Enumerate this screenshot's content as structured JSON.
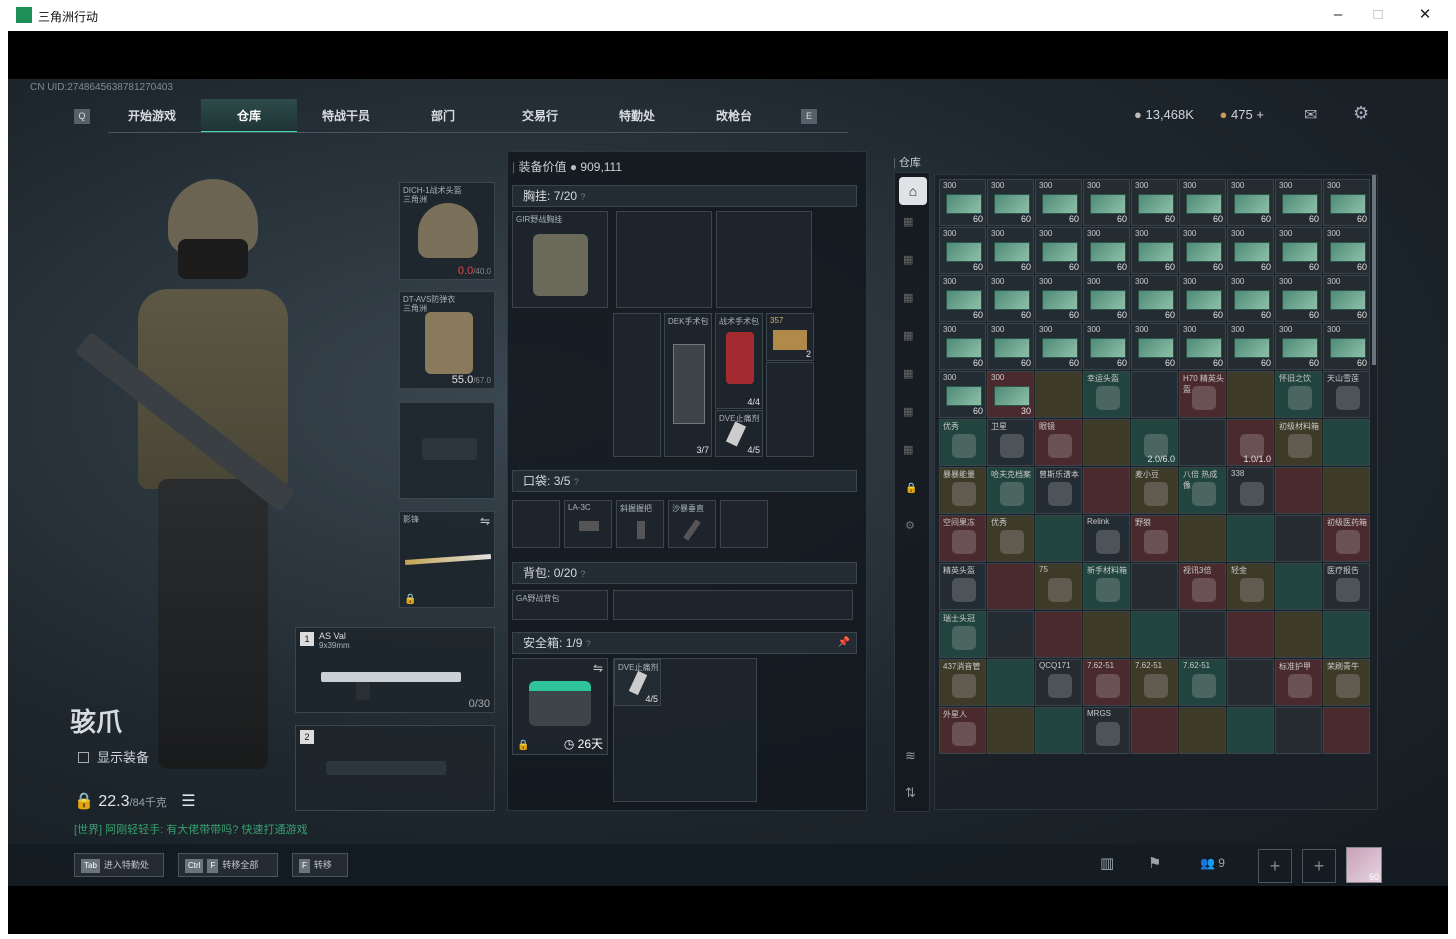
{
  "window": {
    "title": "三角洲行动",
    "minimize": "–",
    "maximize": "□",
    "close": "✕"
  },
  "uid": "CN UID:2748645638781270403",
  "nav": {
    "left_key": "Q",
    "right_key": "E",
    "tabs": [
      "开始游戏",
      "仓库",
      "特战干员",
      "部门",
      "交易行",
      "特勤处",
      "改枪台"
    ],
    "active": "仓库"
  },
  "currency": {
    "coins": "13,468K",
    "premium": "475 +"
  },
  "operator": {
    "name": "骇爪",
    "show_equipment": "显示装备",
    "weight": "22.3",
    "weight_max": "/84千克"
  },
  "chat": "[世界] 阿刚轻轻手: 有大佬带带吗? 快速打通游戏",
  "gear": {
    "helmet": {
      "name": "DICH-1战术头盔",
      "sub": "三角洲",
      "dur": "0.0",
      "dur_max": "/40.0"
    },
    "armor": {
      "name": "DT-AVS防弹衣",
      "sub": "三角洲",
      "dur": "55.0",
      "dur_max": "/67.0"
    },
    "melee": {
      "name": "影锋"
    },
    "weapon1": {
      "num": "1",
      "name": "AS Val",
      "ammo_type": "9x39mm",
      "ammo": "0/30"
    },
    "weapon2": {
      "num": "2"
    }
  },
  "equip_value": {
    "label": "装备价值",
    "value": "909,111"
  },
  "chest": {
    "label": "胸挂:",
    "count": "7/20",
    "rig": "GIR野战胸挂",
    "items": [
      {
        "name": "DEK手术包",
        "count": "3/7"
      },
      {
        "name": "战术手术包",
        "count": "4/4"
      },
      {
        "name": "357",
        "count": "2"
      },
      {
        "name": "DVE止痛剂",
        "count": "4/5"
      }
    ]
  },
  "pocket": {
    "label": "口袋:",
    "count": "3/5",
    "items": [
      "LA-3C",
      "斜握握把",
      "沙暴垂直"
    ]
  },
  "backpack": {
    "label": "背包:",
    "count": "0/20",
    "bag": "GA野战背包"
  },
  "safebox": {
    "label": "安全箱:",
    "count": "1/9",
    "days": "26天",
    "item": "DVE止痛剂",
    "item_count": "4/5"
  },
  "stash": {
    "title": "仓库",
    "cash_value": "300",
    "cash_count": "60",
    "rows": [
      [
        "300|60",
        "300|30",
        "",
        "幸运头盔",
        "",
        "H70 精英头盔",
        "",
        "怀旧之饮",
        "天山雪莲"
      ],
      [
        "优秀",
        "卫星",
        "眼镜",
        "",
        "2.0/6.0",
        "",
        "1.0/1.0",
        "初级材料箱",
        ""
      ],
      [
        "暴暴能量",
        "哈夫克档案",
        "曾斯乐谱本",
        "",
        "麦小豆",
        "八倍 热成像",
        "338",
        "",
        ""
      ],
      [
        "空间果冻",
        "优秀",
        "",
        "Relink",
        "野狼",
        "",
        "",
        "",
        "初级医药箱"
      ],
      [
        "精英头盔",
        "",
        "75",
        "新手材料箱",
        "",
        "视讯3倍",
        "轻金",
        "",
        "医疗报告"
      ],
      [
        "瑞士头冠",
        "",
        "",
        "",
        "",
        "",
        "",
        "",
        ""
      ],
      [
        "437消音管",
        "",
        "QCQ171",
        "7.62-51",
        "7.62-51",
        "7.62-51",
        "",
        "标准护甲",
        "荣刷青牛"
      ],
      [
        "外星人",
        "",
        "",
        "MRGS",
        "",
        "",
        "",
        "",
        ""
      ]
    ],
    "special": [
      "2.0/6.0",
      "1.0/1.0"
    ]
  },
  "bottom": {
    "b1": {
      "key": "Tab",
      "label": "进入特勤处"
    },
    "b2": {
      "key1": "Ctrl",
      "key2": "F",
      "label": "转移全部"
    },
    "b3": {
      "key": "F",
      "label": "转移"
    },
    "friends": "9",
    "avatar_level": "60"
  },
  "colors": {
    "accent": "#3fd7b0",
    "red": "#e0464a",
    "cash": "#6fae94"
  }
}
